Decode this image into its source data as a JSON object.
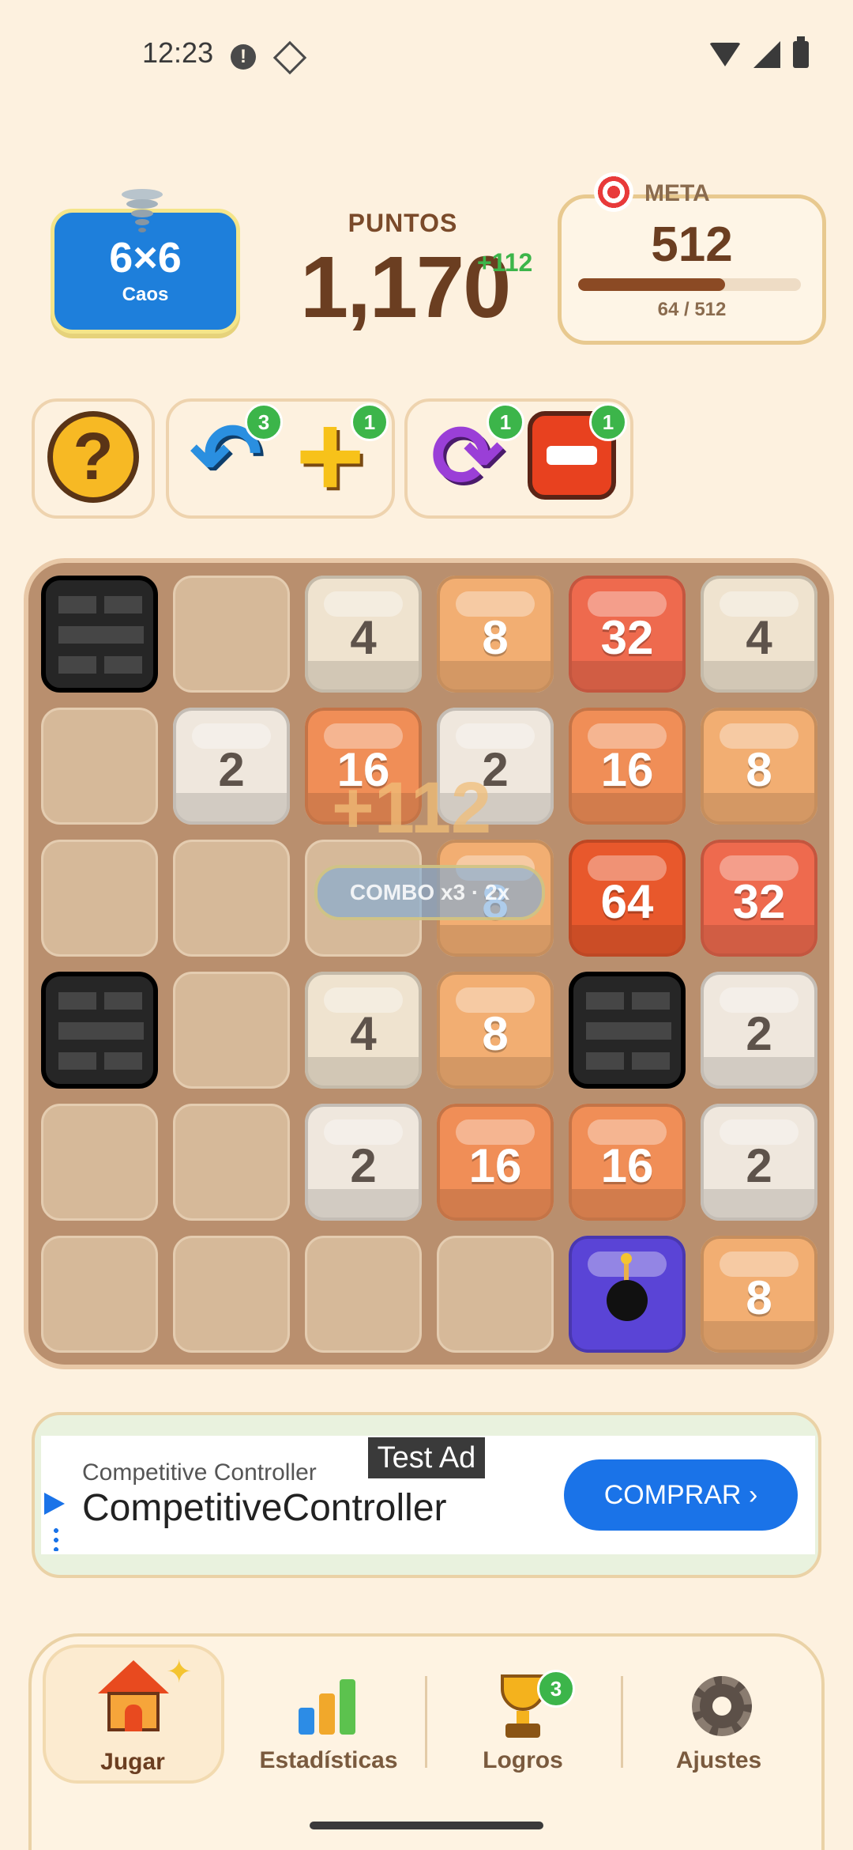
{
  "status_bar": {
    "time": "12:23"
  },
  "header": {
    "mode_size": "6×6",
    "mode_name": "Caos",
    "points_label": "PUNTOS",
    "points_value": "1,170",
    "points_delta": "+112",
    "goal_label": "META",
    "goal_value": "512",
    "goal_progress_text": "64 / 512",
    "goal_progress_fraction": 0.66
  },
  "powerups": {
    "undo_count": "3",
    "add_count": "1",
    "shuffle_count": "1",
    "remove_count": "1"
  },
  "board": {
    "rows": [
      [
        "wall",
        "",
        "4",
        "8",
        "32",
        "4"
      ],
      [
        "",
        "2",
        "16",
        "2",
        "16",
        "8"
      ],
      [
        "",
        "",
        "",
        "8",
        "64",
        "32"
      ],
      [
        "wall",
        "",
        "4",
        "8",
        "wall",
        "2"
      ],
      [
        "",
        "",
        "2",
        "16",
        "16",
        "2"
      ],
      [
        "",
        "",
        "",
        "",
        "bomb",
        "8"
      ]
    ],
    "floating_score": "+112",
    "combo_text": "COMBO x3 · 2x"
  },
  "ad": {
    "tag": "Test Ad",
    "subtitle": "Competitive Controller",
    "title": "CompetitiveController",
    "button": "COMPRAR"
  },
  "nav": {
    "play": "Jugar",
    "stats": "Estadísticas",
    "achievements": "Logros",
    "achievements_badge": "3",
    "settings": "Ajustes"
  },
  "tile_colors": {
    "2": "#EFE7DD",
    "4": "#EFE3CF",
    "8": "#F2AE72",
    "16": "#F08E57",
    "32": "#EE6A4E",
    "64": "#E8582C",
    "bomb": "#5A44D6"
  }
}
